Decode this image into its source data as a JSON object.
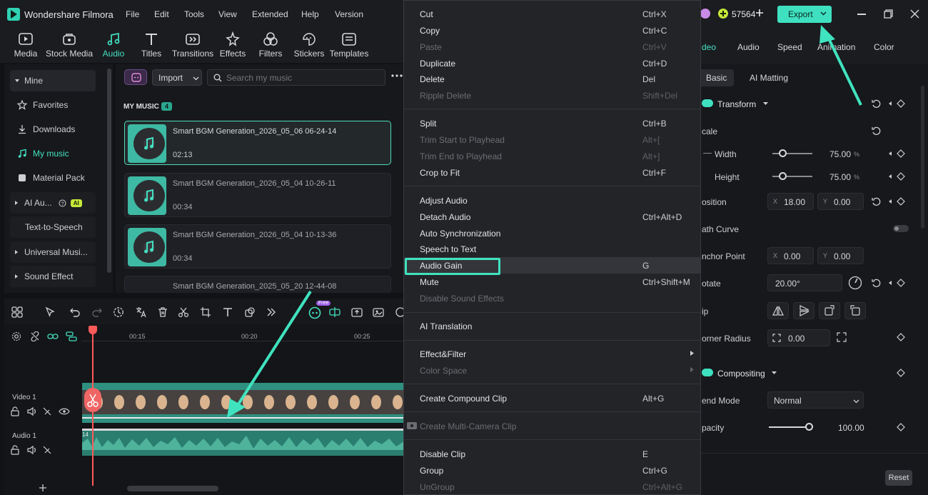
{
  "app": {
    "name": "Wondershare Filmora",
    "menu": [
      "File",
      "Edit",
      "Tools",
      "View",
      "Extended",
      "Help",
      "Version"
    ],
    "credits": "57564",
    "export_label": "Export"
  },
  "tools": [
    {
      "label": "Media",
      "icon": "media-icon"
    },
    {
      "label": "Stock Media",
      "icon": "stock-media-icon"
    },
    {
      "label": "Audio",
      "icon": "audio-icon"
    },
    {
      "label": "Titles",
      "icon": "titles-icon"
    },
    {
      "label": "Transitions",
      "icon": "transitions-icon"
    },
    {
      "label": "Effects",
      "icon": "effects-icon"
    },
    {
      "label": "Filters",
      "icon": "filters-icon"
    },
    {
      "label": "Stickers",
      "icon": "stickers-icon"
    },
    {
      "label": "Templates",
      "icon": "templates-icon"
    }
  ],
  "sidebar": {
    "items": [
      {
        "label": "Mine"
      },
      {
        "label": "Favorites"
      },
      {
        "label": "Downloads"
      },
      {
        "label": "My music"
      },
      {
        "label": "Material Pack"
      },
      {
        "label": "AI Au..."
      },
      {
        "label": "Text-to-Speech"
      },
      {
        "label": "Universal Musi..."
      },
      {
        "label": "Sound Effect"
      }
    ],
    "ai_badge": "AI"
  },
  "music": {
    "import_label": "Import",
    "search_placeholder": "Search my music",
    "section_title": "MY MUSIC",
    "count": "4",
    "items": [
      {
        "name": "Smart BGM Generation_2026_05_06 06-24-14",
        "duration": "02:13"
      },
      {
        "name": "Smart BGM Generation_2026_05_04 10-26-11",
        "duration": "00:34"
      },
      {
        "name": "Smart BGM Generation_2026_05_04 10-13-36",
        "duration": "00:34"
      },
      {
        "name": "Smart BGM Generation_2025_05_20 12-44-08",
        "duration": ""
      }
    ]
  },
  "timeline": {
    "ticks": [
      "00:15",
      "00:20",
      "00:25"
    ],
    "video_track": "Video 1",
    "audio_track": "Audio 1",
    "free_badge": "Free",
    "audio_marker": "14"
  },
  "context_menu": {
    "items": [
      {
        "label": "Cut",
        "shortcut": "Ctrl+X",
        "disabled": false
      },
      {
        "label": "Copy",
        "shortcut": "Ctrl+C",
        "disabled": false
      },
      {
        "label": "Paste",
        "shortcut": "Ctrl+V",
        "disabled": true
      },
      {
        "label": "Duplicate",
        "shortcut": "Ctrl+D",
        "disabled": false
      },
      {
        "label": "Delete",
        "shortcut": "Del",
        "disabled": false
      },
      {
        "label": "Ripple Delete",
        "shortcut": "Shift+Del",
        "disabled": true
      },
      {
        "label": "Split",
        "shortcut": "Ctrl+B",
        "disabled": false
      },
      {
        "label": "Trim Start to Playhead",
        "shortcut": "Alt+[",
        "disabled": true
      },
      {
        "label": "Trim End to Playhead",
        "shortcut": "Alt+]",
        "disabled": true
      },
      {
        "label": "Crop to Fit",
        "shortcut": "Ctrl+F",
        "disabled": false
      },
      {
        "label": "Adjust Audio",
        "shortcut": "",
        "disabled": false
      },
      {
        "label": "Detach Audio",
        "shortcut": "Ctrl+Alt+D",
        "disabled": false
      },
      {
        "label": "Auto Synchronization",
        "shortcut": "",
        "disabled": false
      },
      {
        "label": "Speech to Text",
        "shortcut": "",
        "disabled": false
      },
      {
        "label": "Audio Gain",
        "shortcut": "G",
        "disabled": false
      },
      {
        "label": "Mute",
        "shortcut": "Ctrl+Shift+M",
        "disabled": false
      },
      {
        "label": "Disable Sound Effects",
        "shortcut": "",
        "disabled": true
      },
      {
        "label": "AI Translation",
        "shortcut": "",
        "disabled": false
      },
      {
        "label": "Effect&Filter",
        "shortcut": "",
        "disabled": false
      },
      {
        "label": "Color Space",
        "shortcut": "",
        "disabled": true
      },
      {
        "label": "Create Compound Clip",
        "shortcut": "Alt+G",
        "disabled": false
      },
      {
        "label": "Create Multi-Camera Clip",
        "shortcut": "",
        "disabled": true
      },
      {
        "label": "Disable Clip",
        "shortcut": "E",
        "disabled": false
      },
      {
        "label": "Group",
        "shortcut": "Ctrl+G",
        "disabled": false
      },
      {
        "label": "UnGroup",
        "shortcut": "Ctrl+Alt+G",
        "disabled": true
      }
    ]
  },
  "right_panel": {
    "tabs": [
      "deo",
      "Audio",
      "Speed",
      "Animation",
      "Color"
    ],
    "subtabs": [
      "Basic",
      "AI Matting"
    ],
    "transform": "Transform",
    "scale": "cale",
    "width_label": "Width",
    "width_value": "75.00",
    "height_label": "Height",
    "height_value": "75.00",
    "percent": "%",
    "position": "osition",
    "pos_x": "18.00",
    "pos_y": "0.00",
    "path_curve": "ath Curve",
    "anchor": "nchor Point",
    "anchor_x": "0.00",
    "anchor_y": "0.00",
    "rotate": "otate",
    "rotate_value": "20.00°",
    "flip": "ip",
    "corner": "orner Radius",
    "corner_value": "0.00",
    "compositing": "Compositing",
    "blend": "end Mode",
    "blend_value": "Normal",
    "opacity": "pacity",
    "opacity_value": "100.00",
    "reset": "Reset",
    "axis_x": "X",
    "axis_y": "Y",
    "width_fraction": 0.25,
    "height_fraction": 0.25,
    "opacity_fraction": 1.0
  },
  "colors": {
    "accent": "#3ee0c0",
    "playhead": "#ff5a5a"
  }
}
